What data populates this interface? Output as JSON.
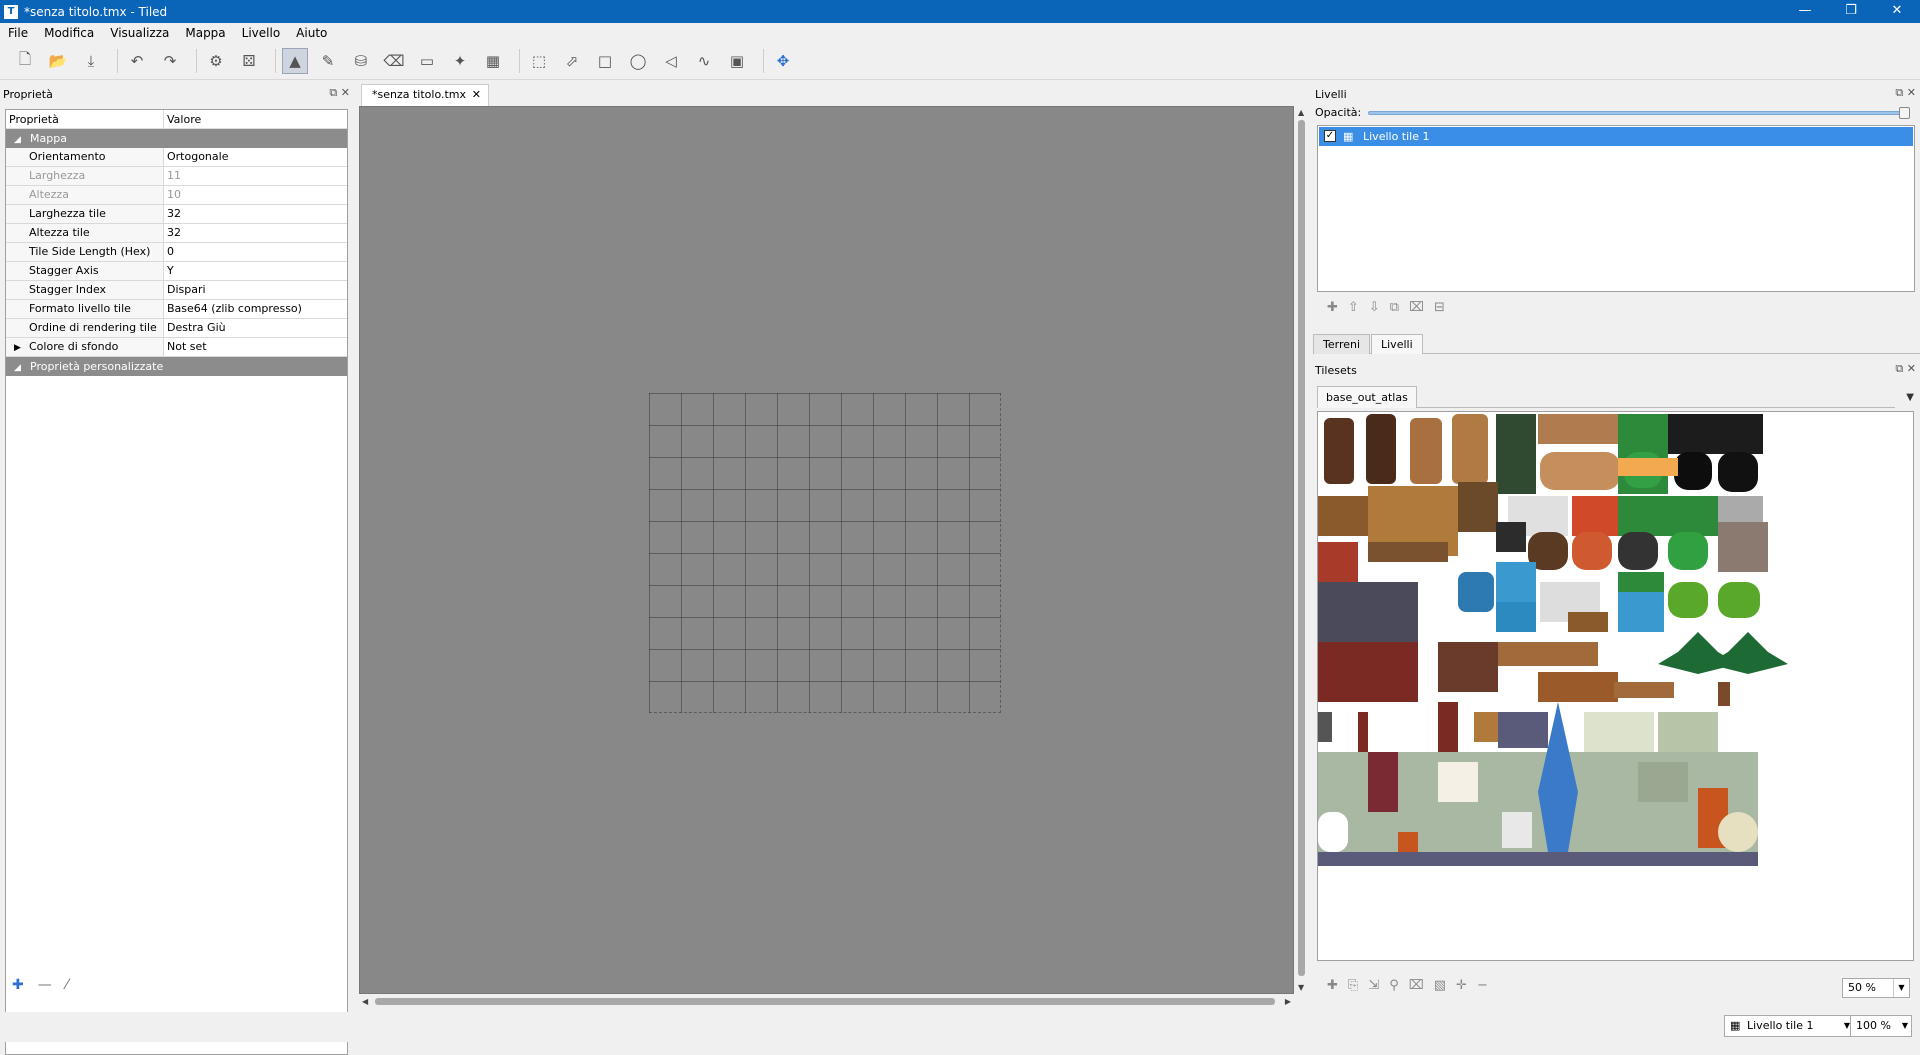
{
  "window": {
    "title": "*senza titolo.tmx - Tiled",
    "app_icon": "T",
    "buttons": [
      "—",
      "❐",
      "✕"
    ]
  },
  "menu": [
    "File",
    "Modifica",
    "Visualizza",
    "Mappa",
    "Livello",
    "Aiuto"
  ],
  "properties_panel": {
    "title": "Proprietà",
    "columns": [
      "Proprietà",
      "Valore"
    ],
    "group_map": "Mappa",
    "rows": [
      {
        "key": "Orientamento",
        "value": "Ortogonale"
      },
      {
        "key": "Larghezza",
        "value": "11"
      },
      {
        "key": "Altezza",
        "value": "10"
      },
      {
        "key": "Larghezza tile",
        "value": "32"
      },
      {
        "key": "Altezza tile",
        "value": "32"
      },
      {
        "key": "Tile Side Length (Hex)",
        "value": "0"
      },
      {
        "key": "Stagger Axis",
        "value": "Y"
      },
      {
        "key": "Stagger Index",
        "value": "Dispari"
      },
      {
        "key": "Formato livello tile",
        "value": "Base64 (zlib compresso)"
      },
      {
        "key": "Ordine di rendering tile",
        "value": "Destra Giù"
      },
      {
        "key": "Colore di sfondo",
        "value": "Not set"
      }
    ],
    "group_custom": "Proprietà personalizzate"
  },
  "editor": {
    "tab": "*senza titolo.tmx",
    "map": {
      "width_tiles": 11,
      "height_tiles": 10
    }
  },
  "layers_panel": {
    "title": "Livelli",
    "opacity_label": "Opacità:",
    "opacity": 1.0,
    "layers": [
      {
        "name": "Livello tile 1",
        "visible": true
      }
    ],
    "tabs": [
      "Terreni",
      "Livelli"
    ]
  },
  "tilesets_panel": {
    "title": "Tilesets",
    "tab": "base_out_atlas",
    "zoom": "50 %"
  },
  "statusbar": {
    "current_layer": "Livello tile 1",
    "zoom": "100 %"
  }
}
